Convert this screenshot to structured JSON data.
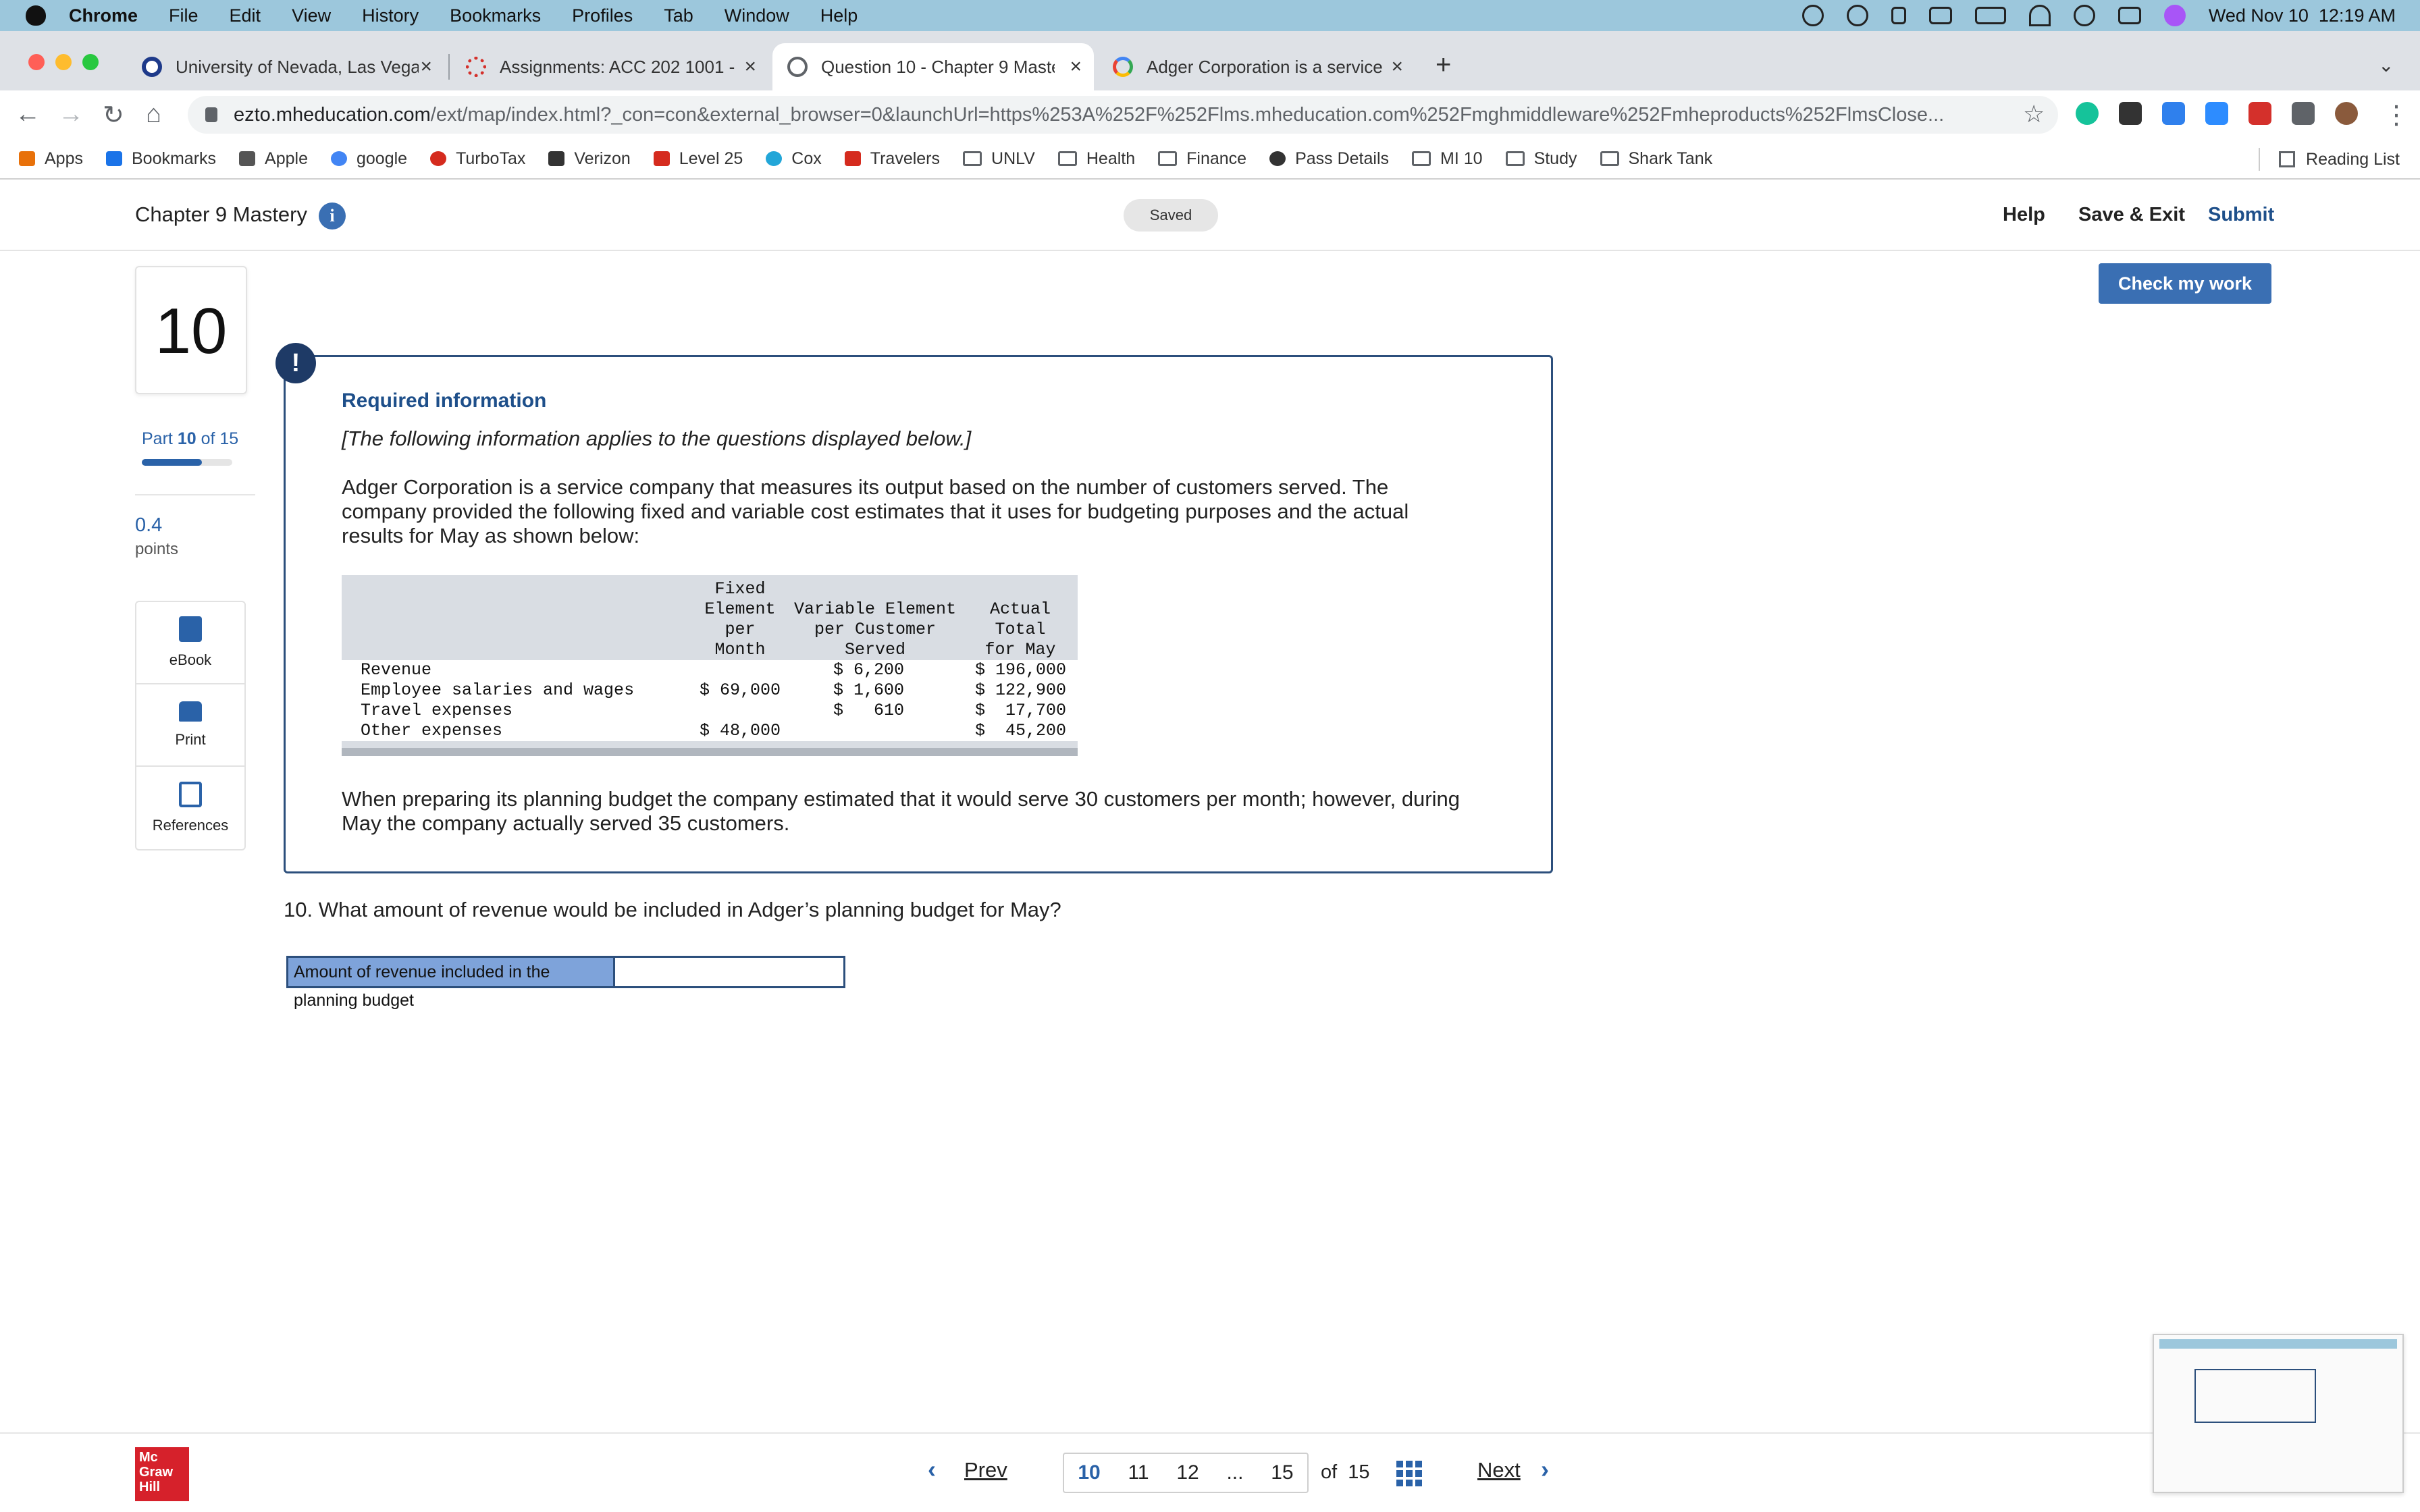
{
  "menubar": {
    "app": "Chrome",
    "items": [
      "File",
      "Edit",
      "View",
      "History",
      "Bookmarks",
      "Profiles",
      "Tab",
      "Window",
      "Help"
    ],
    "datetime": "Wed Nov 10  12:19 AM"
  },
  "tabs": [
    {
      "title": "University of Nevada, Las Vegas",
      "icon": "unlv-icon",
      "color": "#1e3a8a"
    },
    {
      "title": "Assignments: ACC 202 1001 - ",
      "icon": "canvas-icon",
      "color": "#d4302b"
    },
    {
      "title": "Question 10 - Chapter 9 Mastery",
      "icon": "globe-icon",
      "color": "#5f6368"
    },
    {
      "title": "Adger Corporation is a service",
      "icon": "google-icon",
      "color": "#4285f4"
    }
  ],
  "omnibox": {
    "host": "ezto.mheducation.com",
    "path": "/ext/map/index.html?_con=con&external_browser=0&launchUrl=https%253A%252F%252Flms.mheducation.com%252Fmghmiddleware%252Fmheproducts%252FlmsClose..."
  },
  "bookmarks": [
    {
      "label": "Apps",
      "icon": "apps-grid-icon",
      "color": "#e8710a"
    },
    {
      "label": "Bookmarks",
      "icon": "star-icon",
      "color": "#1a73e8"
    },
    {
      "label": "Apple",
      "icon": "apple-icon",
      "color": "#555555"
    },
    {
      "label": "google",
      "icon": "google-icon",
      "color": "#4285f4"
    },
    {
      "label": "TurboTax",
      "icon": "turbotax-icon",
      "color": "#d52b1e"
    },
    {
      "label": "Verizon",
      "icon": "verizon-icon",
      "color": "#333333"
    },
    {
      "label": "Level 25",
      "icon": "level-icon",
      "color": "#d52b1e"
    },
    {
      "label": "Cox",
      "icon": "cox-icon",
      "color": "#22a6d8"
    },
    {
      "label": "Travelers",
      "icon": "umbrella-icon",
      "color": "#d52b1e"
    },
    {
      "label": "UNLV",
      "icon": "folder-icon",
      "color": "#5f6368"
    },
    {
      "label": "Health",
      "icon": "folder-icon",
      "color": "#5f6368"
    },
    {
      "label": "Finance",
      "icon": "folder-icon",
      "color": "#5f6368"
    },
    {
      "label": "Pass Details",
      "icon": "globe-icon",
      "color": "#333333"
    },
    {
      "label": "MI 10",
      "icon": "folder-icon",
      "color": "#5f6368"
    },
    {
      "label": "Study",
      "icon": "folder-icon",
      "color": "#5f6368"
    },
    {
      "label": "Shark Tank",
      "icon": "folder-icon",
      "color": "#5f6368"
    }
  ],
  "reading_list": "Reading List",
  "header": {
    "chapter": "Chapter 9 Mastery",
    "saved": "Saved",
    "help": "Help",
    "save_exit": "Save & Exit",
    "submit": "Submit",
    "accent": "#1e4f8a"
  },
  "sidebar": {
    "question_number": "10",
    "part_word": "Part",
    "part_current": "10",
    "part_of": "of 15",
    "part_progress": 0.6667,
    "points_value": "0.4",
    "points_label": "points",
    "tools": [
      {
        "label": "eBook",
        "icon": "book-icon"
      },
      {
        "label": "Print",
        "icon": "printer-icon"
      },
      {
        "label": "References",
        "icon": "references-icon"
      }
    ]
  },
  "check_button": "Check my work",
  "info": {
    "alert_glyph": "!",
    "title": "Required information",
    "intro": "[The following information applies to the questions displayed below.]",
    "para1_l1": "Adger Corporation is a service company that measures its output based on the number of customers served. The",
    "para1_l2": "company provided the following fixed and variable cost estimates that it uses for budgeting purposes and the actual",
    "para1_l3": "results for May as shown below:",
    "para2_l1": "When preparing its planning budget the company estimated that it would serve 30 customers per month; however, during",
    "para2_l2": "May the company actually served 35 customers."
  },
  "cost_table": {
    "headers": [
      [
        "Fixed",
        "Element",
        "per",
        "Month"
      ],
      [
        "Variable Element",
        "per Customer",
        "Served"
      ],
      [
        "Actual",
        "Total",
        "for May"
      ]
    ],
    "rows": [
      {
        "label": "Revenue",
        "fixed": "",
        "variable": "$ 6,200",
        "actual": "$ 196,000"
      },
      {
        "label": "Employee salaries and wages",
        "fixed": "$ 69,000",
        "variable": "$ 1,600",
        "actual": "$ 122,900"
      },
      {
        "label": "Travel expenses",
        "fixed": "",
        "variable": "$   610",
        "actual": "$  17,700"
      },
      {
        "label": "Other expenses",
        "fixed": "$ 48,000",
        "variable": "",
        "actual": "$  45,200"
      }
    ]
  },
  "question": {
    "text": "10. What amount of revenue would be included in Adger’s planning budget for May?",
    "answer_label": "Amount of revenue included in the planning budget",
    "answer_value": ""
  },
  "footer": {
    "logo_l1": "Mc",
    "logo_l2": "Graw",
    "logo_l3": "Hill",
    "prev": "Prev",
    "next": "Next",
    "pages": [
      "10",
      "11",
      "12",
      "...",
      "15"
    ],
    "of_total": "of  15"
  }
}
